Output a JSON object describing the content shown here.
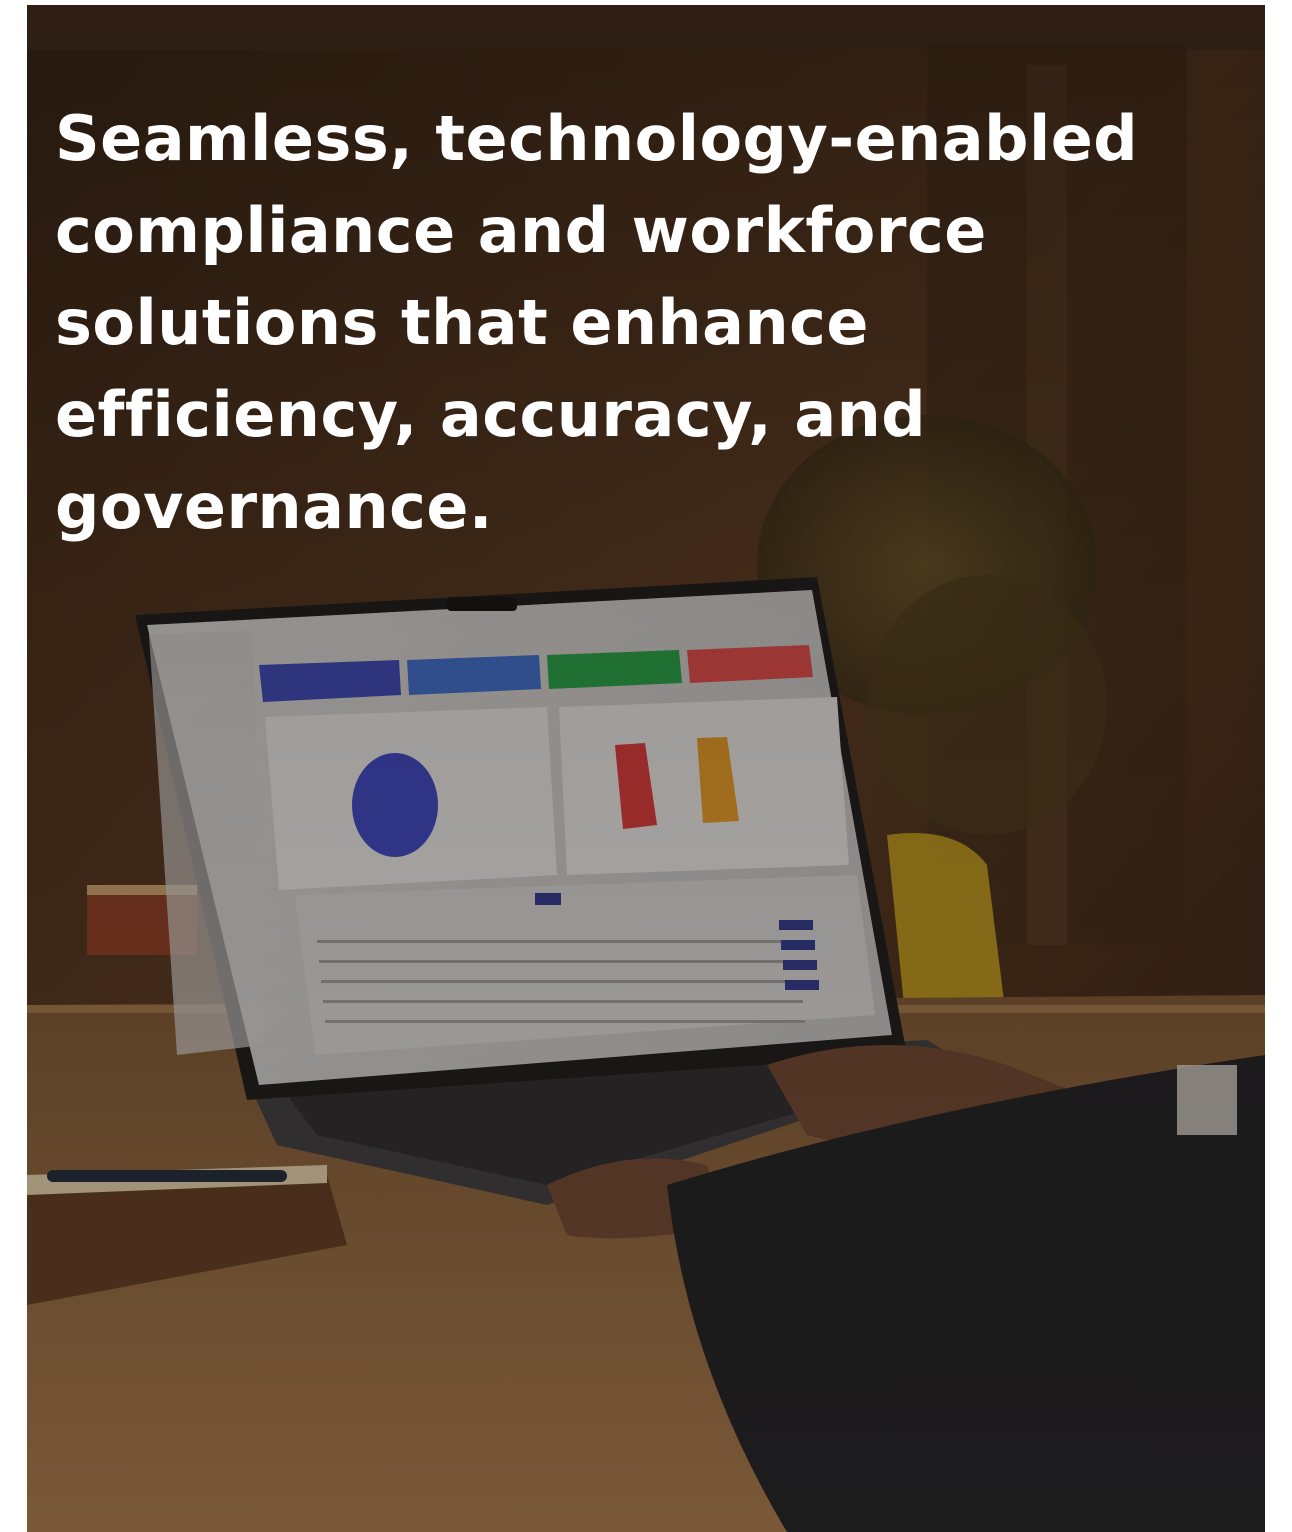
{
  "hero": {
    "headline": "Seamless, technology-enabled compliance and workforce solutions that enhance efficiency, accuracy, and governance."
  },
  "photo": {
    "subject": "laptop-dashboard-photo",
    "dashboard_tile_colors": [
      "#3a49b8",
      "#3d6fd0",
      "#27a349",
      "#e04b4b"
    ],
    "pie_color": "#3c46c2",
    "bar_colors": [
      "#d73a3a",
      "#e39a28"
    ]
  }
}
